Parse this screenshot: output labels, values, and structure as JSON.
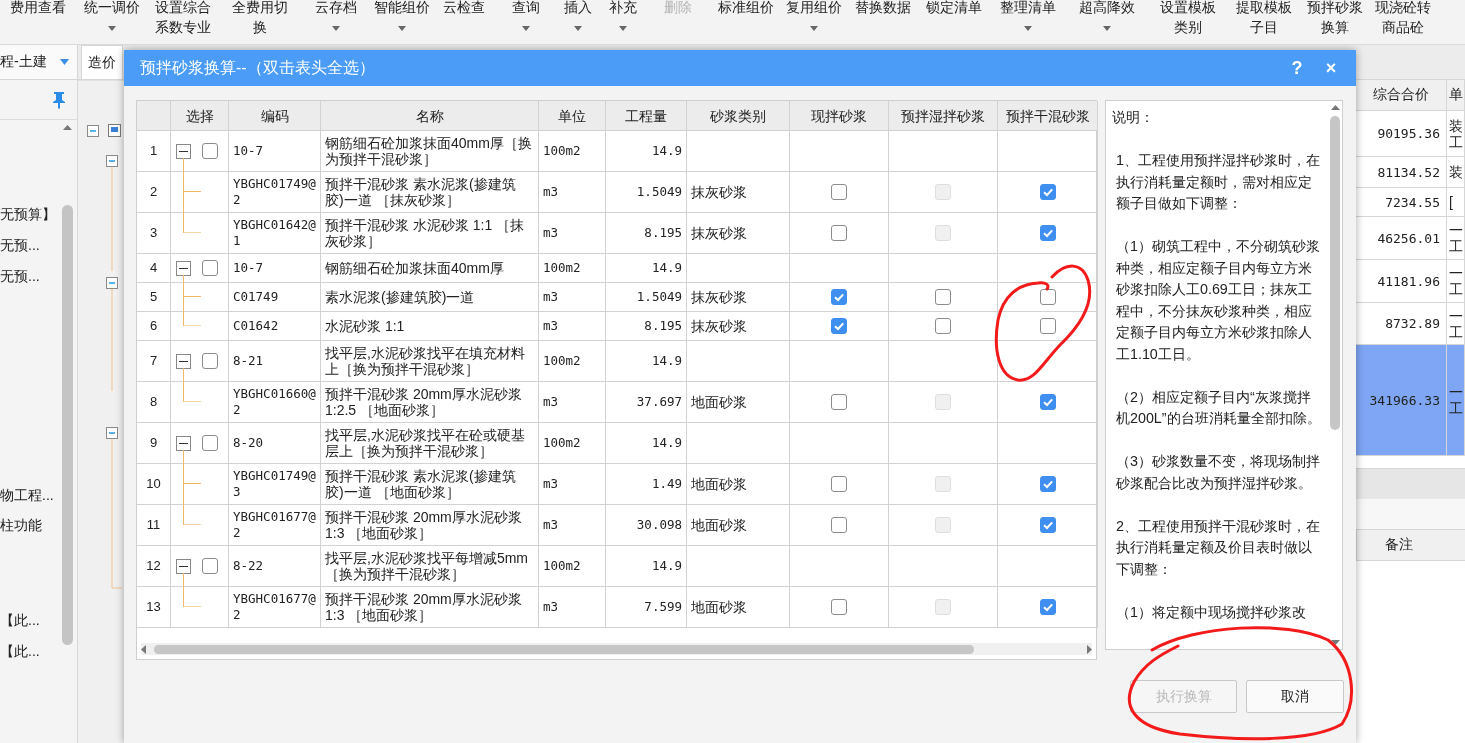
{
  "toolbar": [
    {
      "label": "费用查看",
      "dropdown": false,
      "disabled": false
    },
    {
      "label": "统一调价",
      "dropdown": true,
      "disabled": false
    },
    {
      "label": "设置综合系数专业",
      "dropdown": false,
      "disabled": false
    },
    {
      "label": "全费用切换",
      "dropdown": false,
      "disabled": false
    },
    {
      "label": "云存档",
      "dropdown": true,
      "disabled": false
    },
    {
      "label": "智能组价",
      "dropdown": true,
      "disabled": false
    },
    {
      "label": "云检查",
      "dropdown": false,
      "disabled": false
    },
    {
      "label": "查询",
      "dropdown": true,
      "disabled": false
    },
    {
      "label": "插入",
      "dropdown": true,
      "disabled": false
    },
    {
      "label": "补充",
      "dropdown": true,
      "disabled": false
    },
    {
      "label": "删除",
      "dropdown": false,
      "disabled": true
    },
    {
      "label": "标准组价",
      "dropdown": false,
      "disabled": false
    },
    {
      "label": "复用组价",
      "dropdown": true,
      "disabled": false
    },
    {
      "label": "替换数据",
      "dropdown": false,
      "disabled": false
    },
    {
      "label": "锁定清单",
      "dropdown": false,
      "disabled": false
    },
    {
      "label": "整理清单",
      "dropdown": true,
      "disabled": false
    },
    {
      "label": "超高降效",
      "dropdown": true,
      "disabled": false
    },
    {
      "label": "设置模板类别",
      "dropdown": false,
      "disabled": false
    },
    {
      "label": "提取模板子目",
      "dropdown": false,
      "disabled": false
    },
    {
      "label": "预拌砂浆换算",
      "dropdown": false,
      "disabled": false
    },
    {
      "label": "现浇砼转商品砼",
      "dropdown": false,
      "disabled": false
    }
  ],
  "tab_strip": {
    "project": "程-土建",
    "tab": "造价"
  },
  "left_panel": {
    "items": [
      "无预算】",
      "无预...",
      "无预...",
      "物工程...",
      "柱功能",
      "【此...",
      "【此..."
    ]
  },
  "summary_grid": {
    "columns": [
      "综合合价",
      "单"
    ],
    "rows": [
      {
        "total": "90195.36",
        "column_2": "装工",
        "selected": false
      },
      {
        "total": "81134.52",
        "column_2": "装",
        "selected": false
      },
      {
        "total": "7234.55",
        "column_2": "[",
        "selected": false
      },
      {
        "total": "46256.01",
        "column_2": "一工",
        "selected": false
      },
      {
        "total": "41181.96",
        "column_2": "一工",
        "selected": false
      },
      {
        "total": "8732.89",
        "column_2": "一工",
        "selected": false
      },
      {
        "total": "341966.33",
        "column_2": "一工",
        "selected": true
      }
    ],
    "lower_columns": [
      "备注"
    ]
  },
  "dialog": {
    "title": "预拌砂浆换算--（双击表头全选）",
    "help": "?",
    "close": "×",
    "table": {
      "columns": [
        "",
        "选择",
        "编码",
        "名称",
        "单位",
        "工程量",
        "砂浆类别",
        "现拌砂浆",
        "预拌湿拌砂浆",
        "预拌干混砂浆"
      ],
      "rows": [
        {
          "no": "1",
          "code": "10-7",
          "name": "钢筋细石砼加浆抹面40mm厚［换为预拌干混砂浆］",
          "unit": "100m2",
          "quantity": "14.9",
          "expanded": true,
          "checked": false,
          "children": [
            {
              "no": "2",
              "code": "YBGHC01749@2",
              "name": "预拌干混砂浆 素水泥浆(掺建筑胶)一道 ［抹灰砂浆］",
              "unit": "m3",
              "quantity": "1.5049",
              "mortar_type": "抹灰砂浆",
              "on_site": {
                "checked": false,
                "disabled": false
              },
              "ready_wet": {
                "checked": false,
                "disabled": true
              },
              "ready_dry": {
                "checked": true,
                "disabled": false
              }
            },
            {
              "no": "3",
              "code": "YBGHC01642@1",
              "name": "预拌干混砂浆 水泥砂浆 1:1 ［抹灰砂浆］",
              "unit": "m3",
              "quantity": "8.195",
              "mortar_type": "抹灰砂浆",
              "on_site": {
                "checked": false,
                "disabled": false
              },
              "ready_wet": {
                "checked": false,
                "disabled": true
              },
              "ready_dry": {
                "checked": true,
                "disabled": false
              }
            }
          ]
        },
        {
          "no": "4",
          "code": "10-7",
          "name": "钢筋细石砼加浆抹面40mm厚",
          "unit": "100m2",
          "quantity": "14.9",
          "expanded": true,
          "checked": false,
          "children": [
            {
              "no": "5",
              "code": "C01749",
              "name": "素水泥浆(掺建筑胶)一道",
              "unit": "m3",
              "quantity": "1.5049",
              "mortar_type": "抹灰砂浆",
              "on_site": {
                "checked": true,
                "disabled": false
              },
              "ready_wet": {
                "checked": false,
                "disabled": false
              },
              "ready_dry": {
                "checked": false,
                "disabled": false
              }
            },
            {
              "no": "6",
              "code": "C01642",
              "name": "水泥砂浆 1:1",
              "unit": "m3",
              "quantity": "8.195",
              "mortar_type": "抹灰砂浆",
              "on_site": {
                "checked": true,
                "disabled": false
              },
              "ready_wet": {
                "checked": false,
                "disabled": false
              },
              "ready_dry": {
                "checked": false,
                "disabled": false
              }
            }
          ]
        },
        {
          "no": "7",
          "code": "8-21",
          "name": "找平层,水泥砂浆找平在填充材料上［换为预拌干混砂浆］",
          "unit": "100m2",
          "quantity": "14.9",
          "expanded": true,
          "checked": false,
          "children": [
            {
              "no": "8",
              "code": "YBGHC01660@2",
              "name": "预拌干混砂浆 20mm厚水泥砂浆 1:2.5 ［地面砂浆］",
              "unit": "m3",
              "quantity": "37.697",
              "mortar_type": "地面砂浆",
              "on_site": {
                "checked": false,
                "disabled": false
              },
              "ready_wet": {
                "checked": false,
                "disabled": true
              },
              "ready_dry": {
                "checked": true,
                "disabled": false
              }
            }
          ]
        },
        {
          "no": "9",
          "code": "8-20",
          "name": "找平层,水泥砂浆找平在砼或硬基层上［换为预拌干混砂浆］",
          "unit": "100m2",
          "quantity": "14.9",
          "expanded": true,
          "checked": false,
          "children": [
            {
              "no": "10",
              "code": "YBGHC01749@3",
              "name": "预拌干混砂浆 素水泥浆(掺建筑胶)一道 ［地面砂浆］",
              "unit": "m3",
              "quantity": "1.49",
              "mortar_type": "地面砂浆",
              "on_site": {
                "checked": false,
                "disabled": false
              },
              "ready_wet": {
                "checked": false,
                "disabled": true
              },
              "ready_dry": {
                "checked": true,
                "disabled": false
              }
            },
            {
              "no": "11",
              "code": "YBGHC01677@2",
              "name": "预拌干混砂浆 20mm厚水泥砂浆 1:3 ［地面砂浆］",
              "unit": "m3",
              "quantity": "30.098",
              "mortar_type": "地面砂浆",
              "on_site": {
                "checked": false,
                "disabled": false
              },
              "ready_wet": {
                "checked": false,
                "disabled": true
              },
              "ready_dry": {
                "checked": true,
                "disabled": false
              }
            }
          ]
        },
        {
          "no": "12",
          "code": "8-22",
          "name": "找平层,水泥砂浆找平每增减5mm［换为预拌干混砂浆］",
          "unit": "100m2",
          "quantity": "14.9",
          "expanded": true,
          "checked": false,
          "children": [
            {
              "no": "13",
              "code": "YBGHC01677@2",
              "name": "预拌干混砂浆 20mm厚水泥砂浆 1:3 ［地面砂浆］",
              "unit": "m3",
              "quantity": "7.599",
              "mortar_type": "地面砂浆",
              "on_site": {
                "checked": false,
                "disabled": false
              },
              "ready_wet": {
                "checked": false,
                "disabled": true
              },
              "ready_dry": {
                "checked": true,
                "disabled": false
              }
            }
          ]
        }
      ]
    },
    "notes": [
      "说明：",
      "1、工程使用预拌湿拌砂浆时，在执行消耗量定额时，需对相应定额子目做如下调整：",
      "（1）砌筑工程中，不分砌筑砂浆种类，相应定额子目内每立方米砂浆扣除人工0.69工日；抹灰工程中，不分抹灰砂浆种类，相应定额子目内每立方米砂浆扣除人工1.10工日。",
      "（2）相应定额子目内“灰浆搅拌机200L”的台班消耗量全部扣除。",
      "（3）砂浆数量不变，将现场制拌砂浆配合比改为预拌湿拌砂浆。",
      "2、工程使用预拌干混砂浆时，在执行消耗量定额及价目表时做以下调整：",
      "（1）将定额中现场搅拌砂浆改"
    ],
    "buttons": [
      {
        "label": "执行换算",
        "disabled": true
      },
      {
        "label": "取消",
        "disabled": false
      }
    ]
  }
}
